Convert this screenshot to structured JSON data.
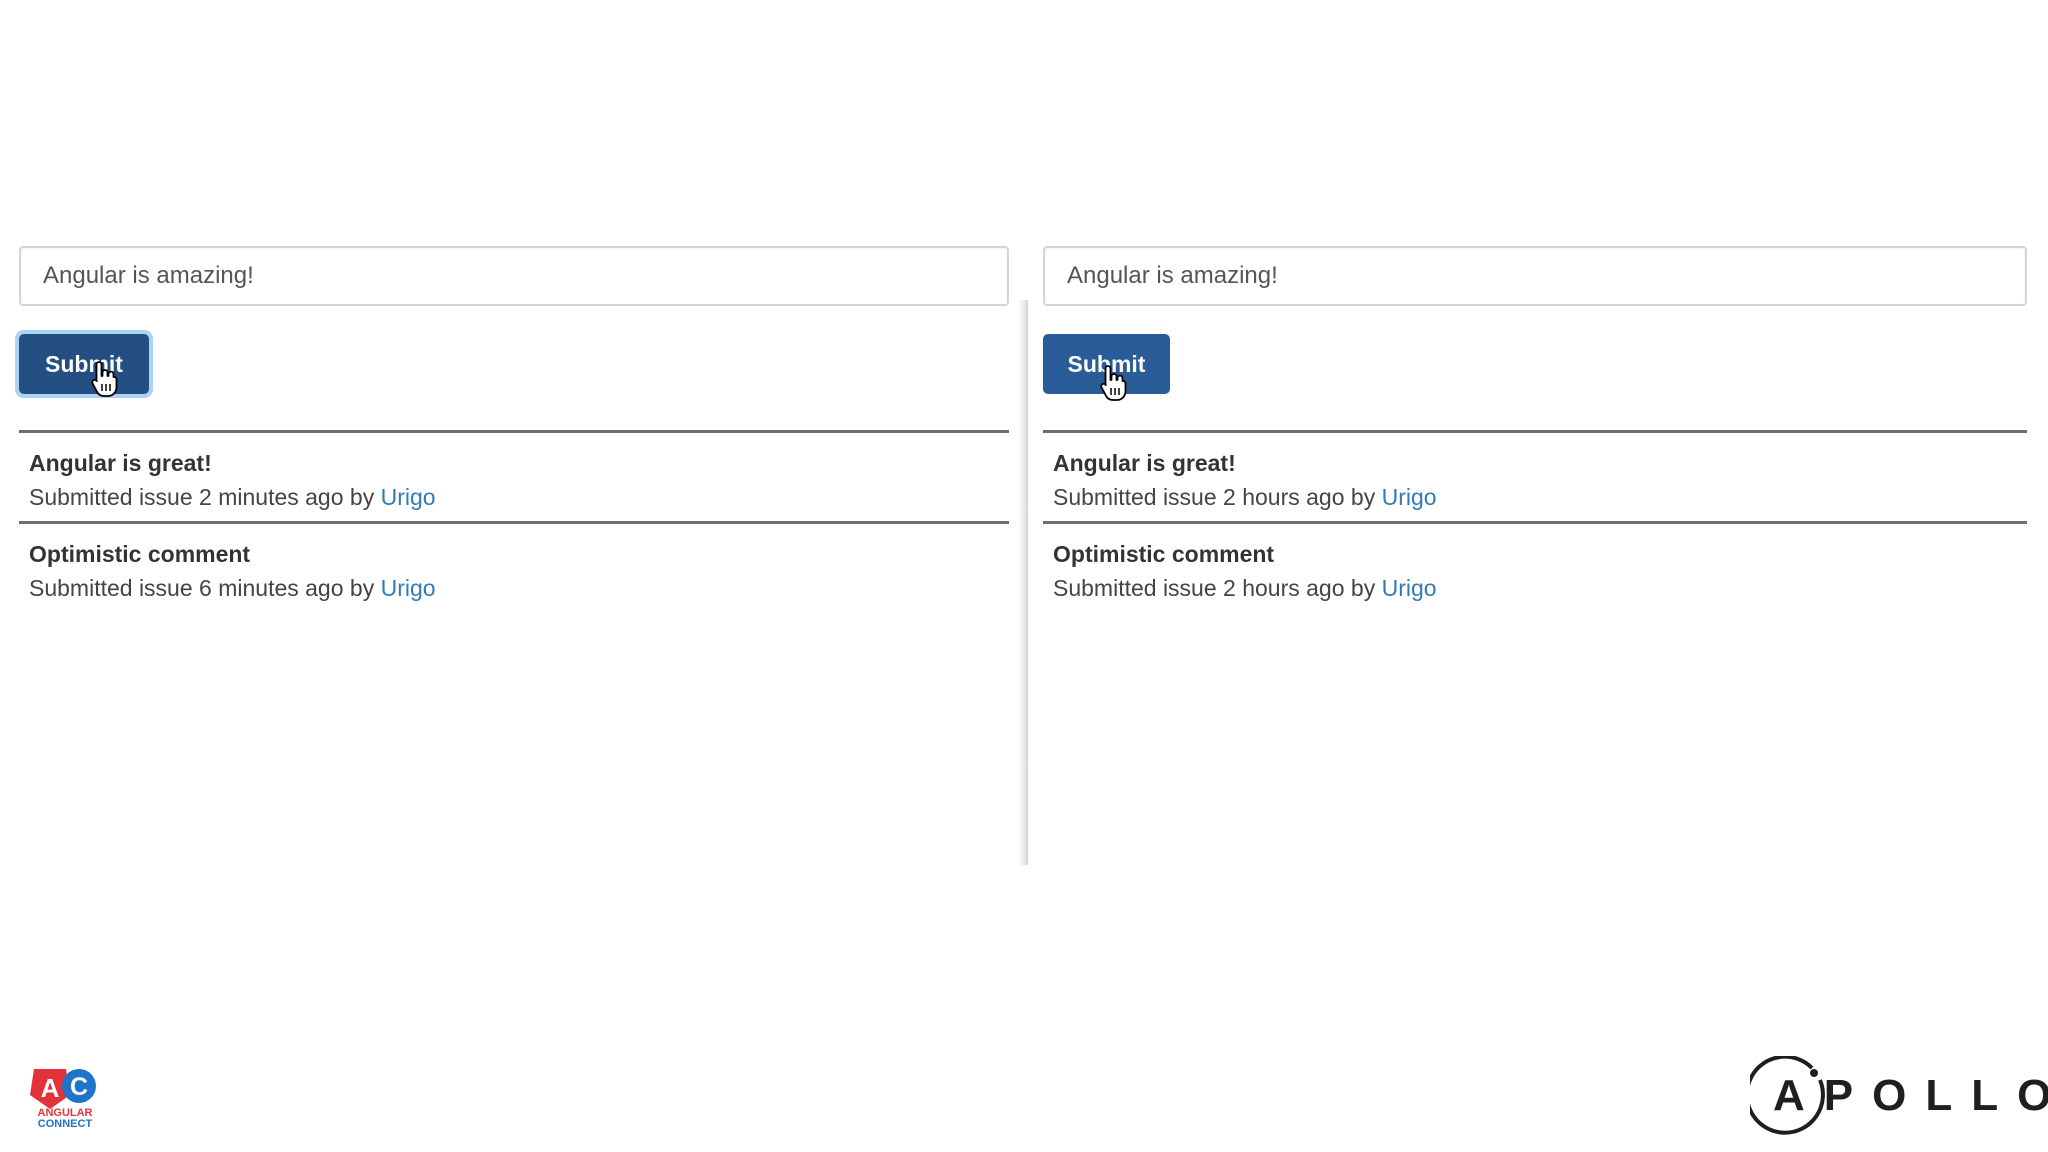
{
  "panels": [
    {
      "input": {
        "value": "Angular is amazing!"
      },
      "submit_label": "Submit",
      "items": [
        {
          "title": "Angular is great!",
          "meta_prefix": "Submitted issue 2 minutes ago by ",
          "author": "Urigo"
        },
        {
          "title": "Optimistic comment",
          "meta_prefix": "Submitted issue 6 minutes ago by ",
          "author": "Urigo"
        }
      ]
    },
    {
      "input": {
        "value": "Angular is amazing!"
      },
      "submit_label": "Submit",
      "items": [
        {
          "title": "Angular is great!",
          "meta_prefix": "Submitted issue 2 hours ago by ",
          "author": "Urigo"
        },
        {
          "title": "Optimistic comment",
          "meta_prefix": "Submitted issue 2 hours ago by ",
          "author": "Urigo"
        }
      ]
    }
  ],
  "logos": {
    "left_line1": "ANGULAR",
    "left_line2": "CONNECT",
    "right": "APOLLO"
  },
  "colors": {
    "button": "#2a5d97",
    "link": "#337ab7",
    "ac_red": "#e2323a",
    "ac_blue": "#1f73c9"
  },
  "icons": {
    "cursor": "hand-pointer-icon"
  }
}
